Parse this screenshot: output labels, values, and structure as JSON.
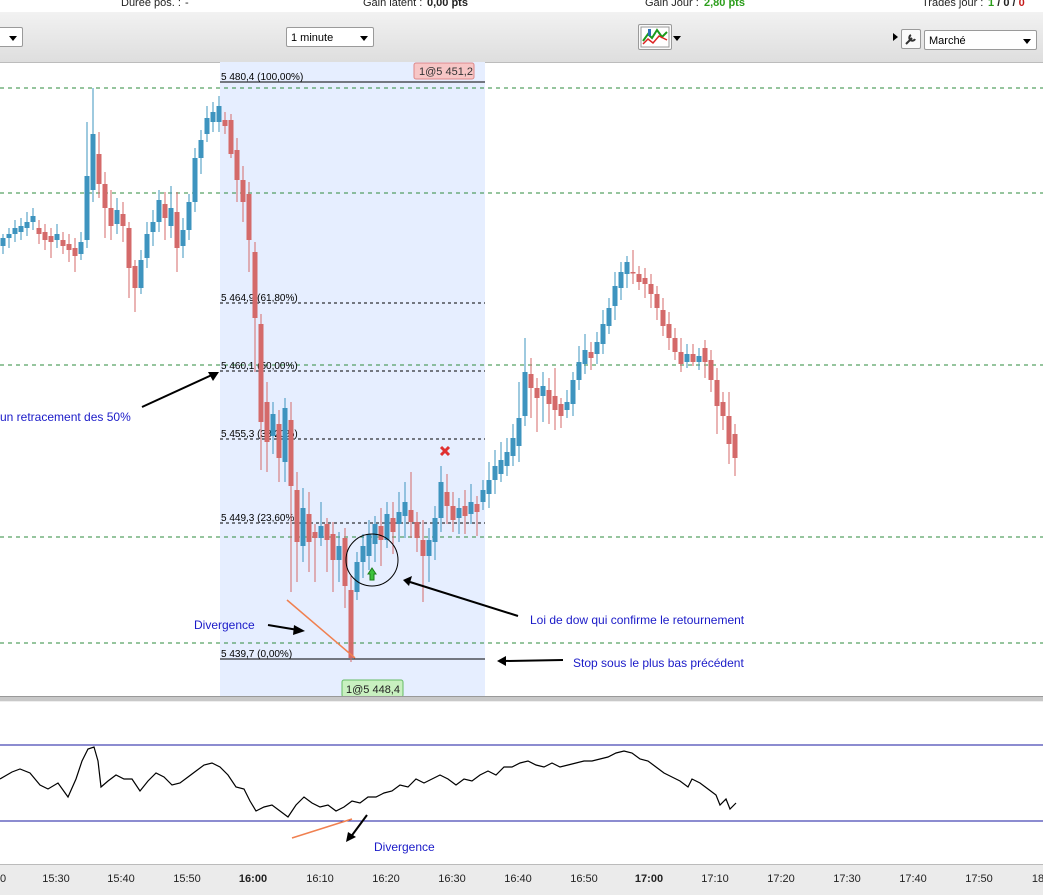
{
  "status": {
    "duree_label": "Durée pos. :",
    "duree_value": "-",
    "gain_latent_label": "Gain latent :",
    "gain_latent_value": "0,00 pts",
    "gain_jour_label": "Gain Jour :",
    "gain_jour_value": "2,80 pts",
    "trades_label": "Trades jour :",
    "trades_a": "1",
    "trades_b": "0",
    "trades_c": "0",
    "sep": "/"
  },
  "toolbar": {
    "interval_value": "1 minute",
    "order_type_value": "Marché"
  },
  "fibo": {
    "l100": "5 480,4 (100,00%)",
    "l618": "5 464,9 (61,80%)",
    "l50": "5 460,1 (50,00%)",
    "l382": "5 455,3 (38,20%)",
    "l236": "5 449,3 (23,60%)",
    "l0": "5 439,7 (0,00%)"
  },
  "orders": {
    "sell": "1@5 451,2",
    "buy": "1@5 448,4"
  },
  "annotations": {
    "retracement": "un retracement des 50%",
    "divergence": "Divergence",
    "dow": "Loi de dow qui confirme le retournement",
    "stop": "Stop sous le plus bas précédent",
    "divergence_ind": "Divergence"
  },
  "time_axis": [
    "0",
    "15:30",
    "15:40",
    "15:50",
    "16:00",
    "16:10",
    "16:20",
    "16:30",
    "16:40",
    "16:50",
    "17:00",
    "17:10",
    "17:20",
    "17:30",
    "17:40",
    "17:50",
    "18"
  ],
  "time_axis_bold": [
    "16:00",
    "17:00"
  ],
  "colors": {
    "up_candle": "#3e94bf",
    "down_candle": "#d46a6a",
    "fibo_zone": "#e6eeff",
    "grid_dash": "#2e8b3e",
    "annotation_text": "#1a1ac8",
    "divergence_line": "#f08050",
    "indicator_band": "#1a1aa0"
  }
}
